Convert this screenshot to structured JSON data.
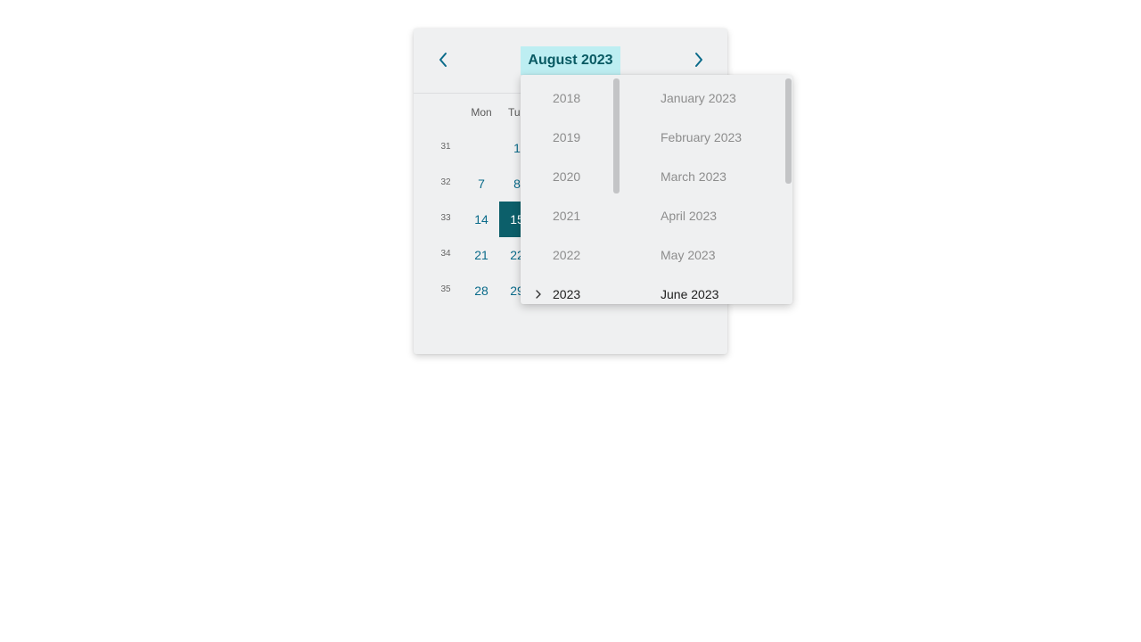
{
  "calendar": {
    "title": "August 2023",
    "weekdays": [
      "Mon",
      "Tu"
    ],
    "weeks": [
      {
        "num": "31",
        "days": [
          "",
          "1"
        ]
      },
      {
        "num": "32",
        "days": [
          "7",
          "8"
        ]
      },
      {
        "num": "33",
        "days": [
          "14",
          "15"
        ]
      },
      {
        "num": "34",
        "days": [
          "21",
          "22"
        ]
      },
      {
        "num": "35",
        "days": [
          "28",
          "29"
        ]
      }
    ],
    "selected_day": "15"
  },
  "picker": {
    "years": [
      "2018",
      "2019",
      "2020",
      "2021",
      "2022",
      "2023"
    ],
    "months": [
      "January 2023",
      "February 2023",
      "March 2023",
      "April 2023",
      "May 2023",
      "June 2023"
    ],
    "current_year": "2023",
    "current_month": "June 2023"
  },
  "colors": {
    "accent": "#0a6b8a",
    "selected_bg": "#0c5f6a",
    "title_bg": "#bdeef2",
    "panel_bg": "#eff0f1"
  }
}
